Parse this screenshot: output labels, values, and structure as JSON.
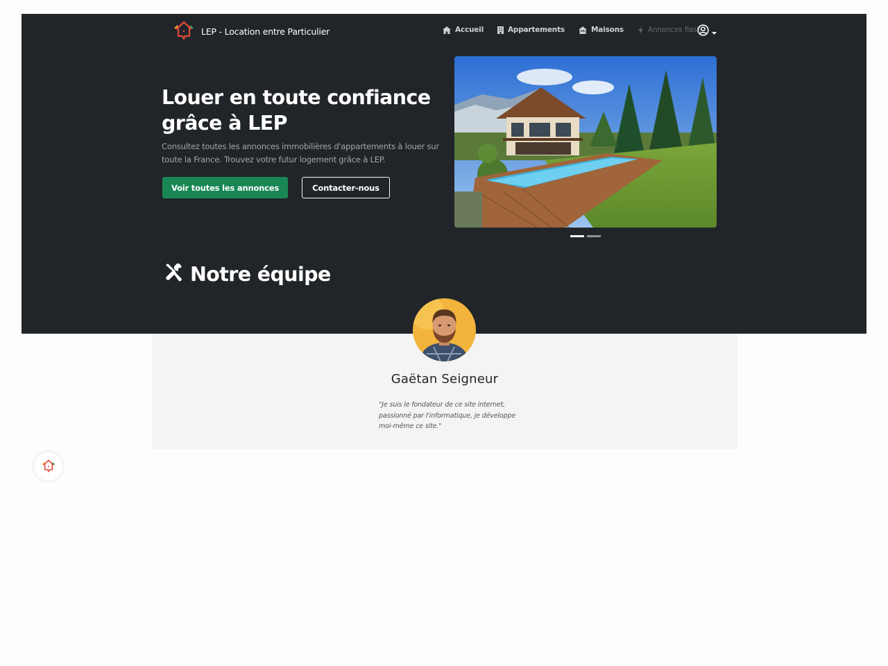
{
  "app": {
    "brand_title": "LEP - Location entre Particulier"
  },
  "nav": {
    "items": [
      {
        "label": "Accueil",
        "icon": "home-icon"
      },
      {
        "label": "Appartements",
        "icon": "building-icon"
      },
      {
        "label": "Maisons",
        "icon": "house-icon"
      },
      {
        "label": "Annonces flash",
        "icon": "bolt-icon",
        "disabled": true
      }
    ],
    "user_icon": "user-circle-icon"
  },
  "hero": {
    "title": "Louer en toute confiance grâce à LEP",
    "lead": "Consultez toutes les annonces immobilières d'appartements à louer sur toute la France. Trouvez votre futur logement grâce à LEP.",
    "primary_button": "Voir toutes les annonces",
    "secondary_button": "Contacter-nous"
  },
  "carousel": {
    "slide_count": 2,
    "active_slide": 1,
    "image": "house-with-pool-photo"
  },
  "team": {
    "heading": "Notre équipe",
    "heading_icon": "tools-icon",
    "members": [
      {
        "name": "Gaëtan Seigneur",
        "quote": "\"Je suis le fondateur de ce site internet, passionné par l'informatique, je développe moi-même ce site.\""
      }
    ]
  },
  "colors": {
    "dark_bg": "#212529",
    "primary": "#198754",
    "light_band": "#f4f4f4",
    "logo_red": "#e04a3a"
  }
}
